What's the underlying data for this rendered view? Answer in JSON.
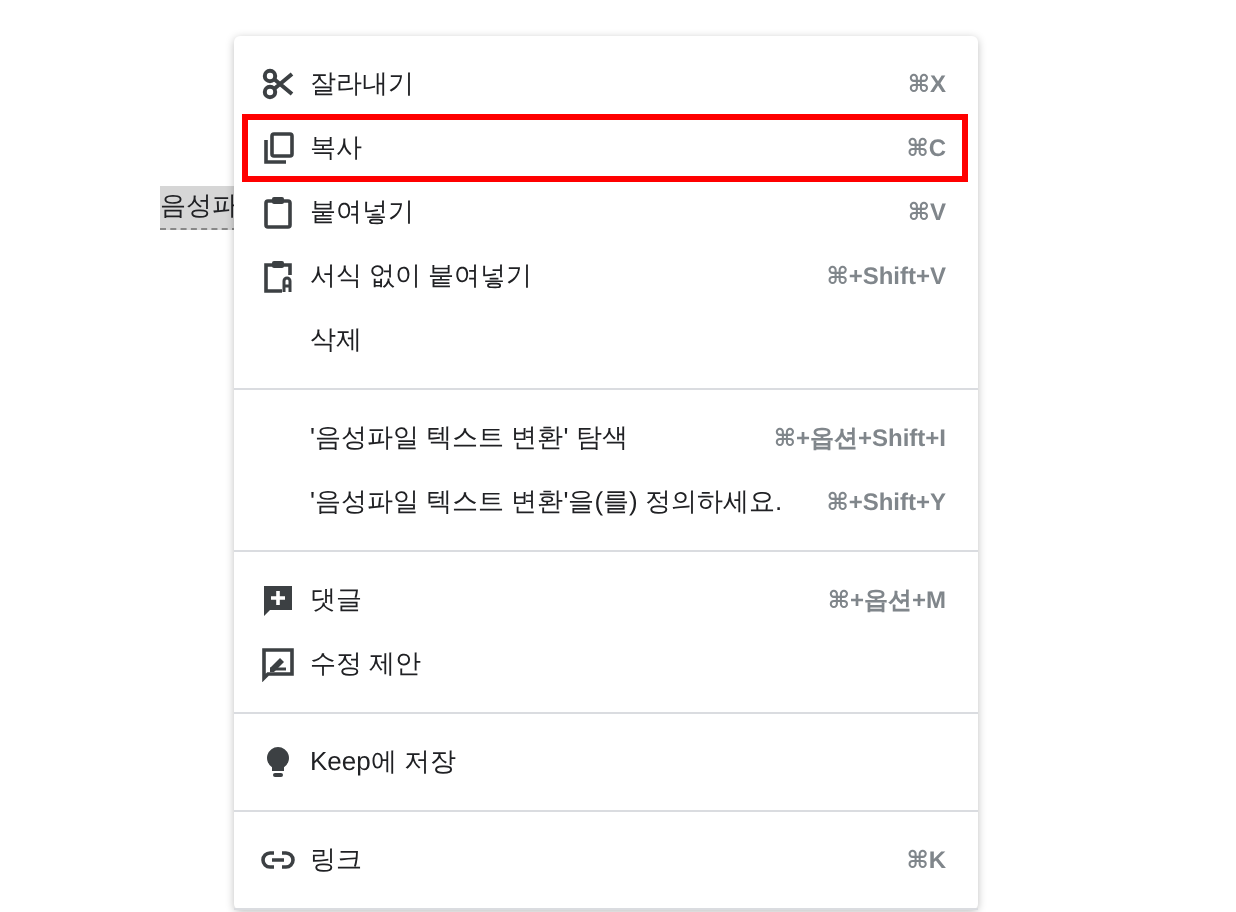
{
  "document": {
    "selected_text": "음성파"
  },
  "context_menu": {
    "groups": [
      {
        "items": [
          {
            "label": "잘라내기",
            "shortcut": "⌘X",
            "highlighted": false
          },
          {
            "label": "복사",
            "shortcut": "⌘C",
            "highlighted": true
          },
          {
            "label": "붙여넣기",
            "shortcut": "⌘V",
            "highlighted": false
          },
          {
            "label": "서식 없이 붙여넣기",
            "shortcut": "⌘+Shift+V",
            "highlighted": false
          },
          {
            "label": "삭제",
            "highlighted": false
          }
        ]
      },
      {
        "items": [
          {
            "label": "'음성파일 텍스트 변환' 탐색",
            "shortcut": "⌘+옵션+Shift+I",
            "highlighted": false
          },
          {
            "label": "'음성파일 텍스트 변환'을(를) 정의하세요.",
            "shortcut": "⌘+Shift+Y",
            "highlighted": false
          }
        ]
      },
      {
        "items": [
          {
            "label": "댓글",
            "shortcut": "⌘+옵션+M",
            "highlighted": false
          },
          {
            "label": "수정 제안",
            "highlighted": false
          }
        ]
      },
      {
        "items": [
          {
            "label": "Keep에 저장",
            "highlighted": false
          }
        ]
      },
      {
        "items": [
          {
            "label": "링크",
            "shortcut": "⌘K",
            "highlighted": false
          }
        ]
      }
    ]
  }
}
